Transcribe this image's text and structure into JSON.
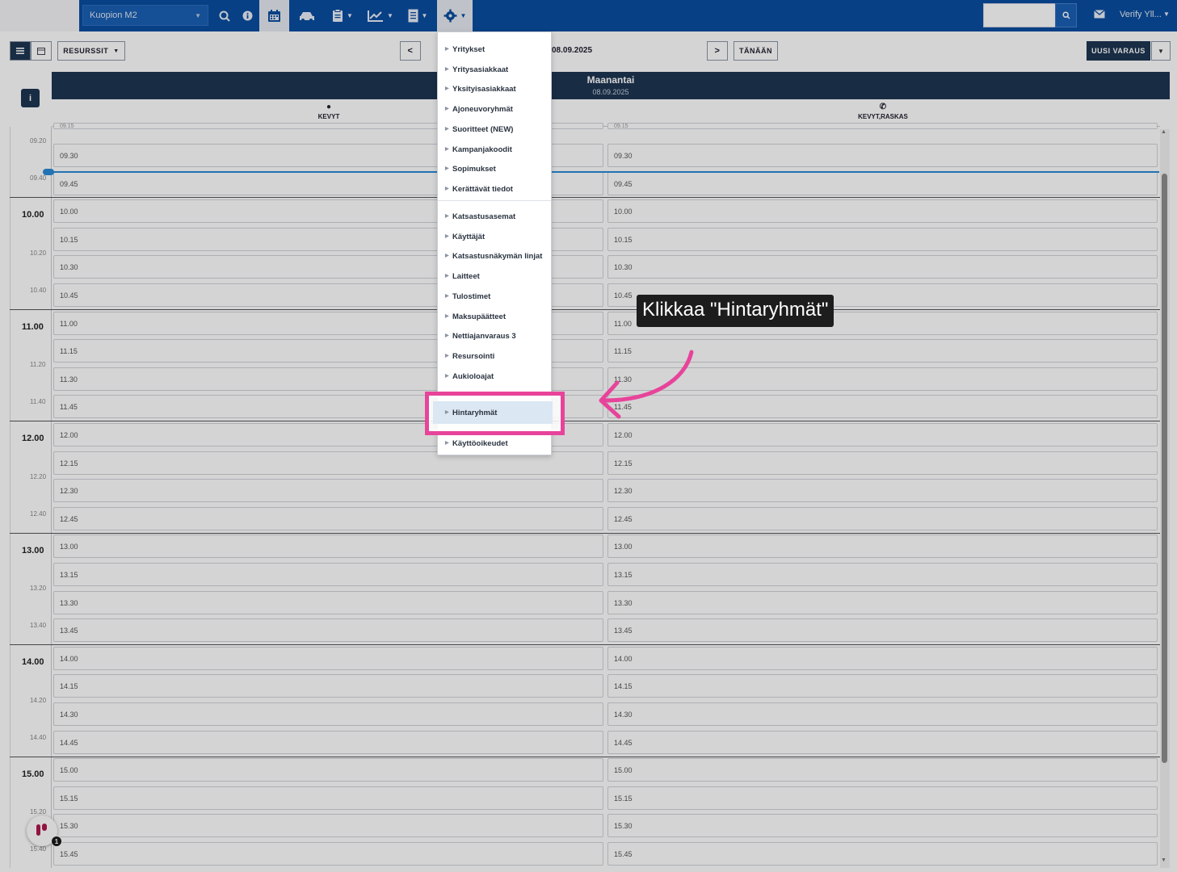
{
  "topbar": {
    "location": "Kuopion M2",
    "user": "Verify Yll...",
    "search_placeholder": ""
  },
  "toolbar": {
    "resources_label": "RESURSSIT",
    "date": "08.09.2025",
    "today_label": "TÄNÄÄN",
    "new_booking_label": "UUSI VARAUS"
  },
  "calendar": {
    "day_name": "Maanantai",
    "day_date": "08.09.2025",
    "columns": [
      {
        "name": "KEVYT",
        "icon": "globe-icon"
      },
      {
        "name": "KEVYT,RASKAS",
        "icon": "phone-icon"
      }
    ],
    "hours": [
      "10.00",
      "11.00",
      "12.00",
      "13.00",
      "14.00",
      "15.00"
    ],
    "minor_marks": [
      "09.20",
      "09.40",
      "10.20",
      "10.40",
      "11.20",
      "11.40",
      "12.20",
      "12.40",
      "13.20",
      "13.40",
      "14.20",
      "14.40",
      "15.20",
      "15.40"
    ],
    "slots": [
      "09.30",
      "09.45",
      "10.00",
      "10.15",
      "10.30",
      "10.45",
      "11.00",
      "11.15",
      "11.30",
      "11.45",
      "12.00",
      "12.15",
      "12.30",
      "12.45",
      "13.00",
      "13.15",
      "13.30",
      "13.45",
      "14.00",
      "14.15",
      "14.30",
      "14.45",
      "15.00",
      "15.15",
      "15.30",
      "15.45"
    ],
    "partial_top_slot": "09.15"
  },
  "menu": {
    "items": [
      "Yritykset",
      "Yritysasiakkaat",
      "Yksityisasiakkaat",
      "Ajoneuvoryhmät",
      "Suoritteet (NEW)",
      "Kampanjakoodit",
      "Sopimukset",
      "Kerättävät tiedot"
    ],
    "items2": [
      "Katsastusasemat",
      "Käyttäjät",
      "Katsastusnäkymän linjat",
      "Laitteet",
      "Tulostimet",
      "Maksupäätteet",
      "Nettiajanvaraus 3",
      "Resursointi",
      "Aukioloajat"
    ],
    "highlighted": "Hintaryhmät",
    "last": "Käyttöoikeudet"
  },
  "annotation": {
    "text": "Klikkaa \"Hintaryhmät\"",
    "color": "#e8439a"
  },
  "help": {
    "count": "1"
  },
  "colors": {
    "nav": "#0a4da0",
    "header": "#1e3552",
    "now_line": "#2a8bd8"
  }
}
